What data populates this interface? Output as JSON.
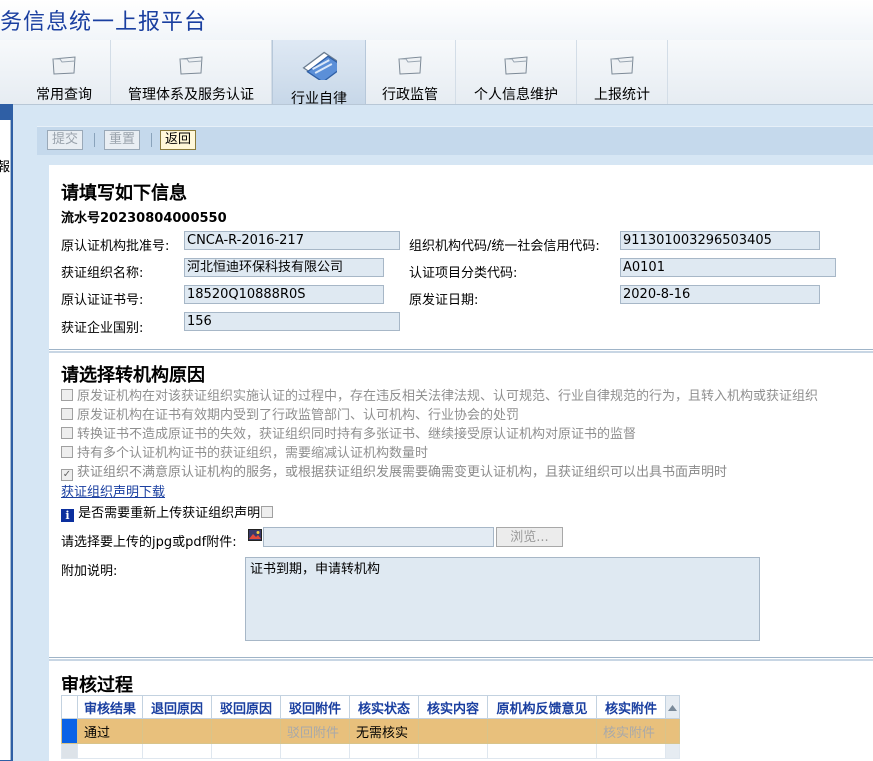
{
  "app": {
    "title": "务信息统一上报平台"
  },
  "tabs": [
    {
      "label": "常用查询",
      "icon": "folder-icon"
    },
    {
      "label": "管理体系及服务认证",
      "icon": "folder-icon"
    },
    {
      "label": "行业自律",
      "icon": "documents-icon",
      "active": true
    },
    {
      "label": "行政监管",
      "icon": "folder-icon"
    },
    {
      "label": "个人信息维护",
      "icon": "folder-icon"
    },
    {
      "label": "上报统计",
      "icon": "folder-icon"
    }
  ],
  "left_panel": {
    "text": "報"
  },
  "toolbar": {
    "submit": "提交",
    "reset": "重置",
    "back": "返回"
  },
  "info": {
    "title": "请填写如下信息",
    "serial": "流水号20230804000550",
    "approval_label": "原认证机构批准号:",
    "approval_value": "CNCA-R-2016-217",
    "org_code_label": "组织机构代码/统一社会信用代码:",
    "org_code_value": "911301003296503405",
    "org_name_label": "获证组织名称:",
    "org_name_value": "河北恒迪环保科技有限公司",
    "category_label": "认证项目分类代码:",
    "category_value": "A0101",
    "cert_no_label": "原认证证书号:",
    "cert_no_value": "18520Q10888R0S",
    "issue_date_label": "原发证日期:",
    "issue_date_value": "2020-8-16",
    "country_label": "获证企业国别:",
    "country_value": "156"
  },
  "reasons": {
    "title": "请选择转机构原因",
    "items": [
      {
        "text": "原发证机构在对该获证组织实施认证的过程中，存在违反相关法律法规、认可规范、行业自律规范的行为，且转入机构或获证组织",
        "checked": false
      },
      {
        "text": "原发证机构在证书有效期内受到了行政监管部门、认可机构、行业协会的处罚",
        "checked": false
      },
      {
        "text": "转换证书不造成原证书的失效，获证组织同时持有多张证书、继续接受原认证机构对原证书的监督",
        "checked": false
      },
      {
        "text": "持有多个认证机构证书的获证组织，需要缩减认证机构数量时",
        "checked": false
      },
      {
        "text": "获证组织不满意原认证机构的服务，或根据获证组织发展需要确需变更认证机构，且获证组织可以出具书面声明时",
        "checked": true
      }
    ],
    "download_link": "获证组织声明下载",
    "reupload_label": "是否需要重新上传获证组织声明",
    "upload_label": "请选择要上传的jpg或pdf附件:",
    "browse_label": "浏览...",
    "remark_label": "附加说明:",
    "remark_value": "证书到期，申请转机构"
  },
  "review": {
    "title": "审核过程",
    "columns": [
      "审核结果",
      "退回原因",
      "驳回原因",
      "驳回附件",
      "核实状态",
      "核实内容",
      "原机构反馈意见",
      "核实附件"
    ],
    "rows": [
      [
        "通过",
        "",
        "",
        "驳回附件",
        "无需核实",
        "",
        "",
        "核实附件"
      ]
    ]
  },
  "colors": {
    "accent": "#1a3fa0",
    "selected_row": "#e8c07c",
    "panel_bg": "#d6e6f4"
  }
}
